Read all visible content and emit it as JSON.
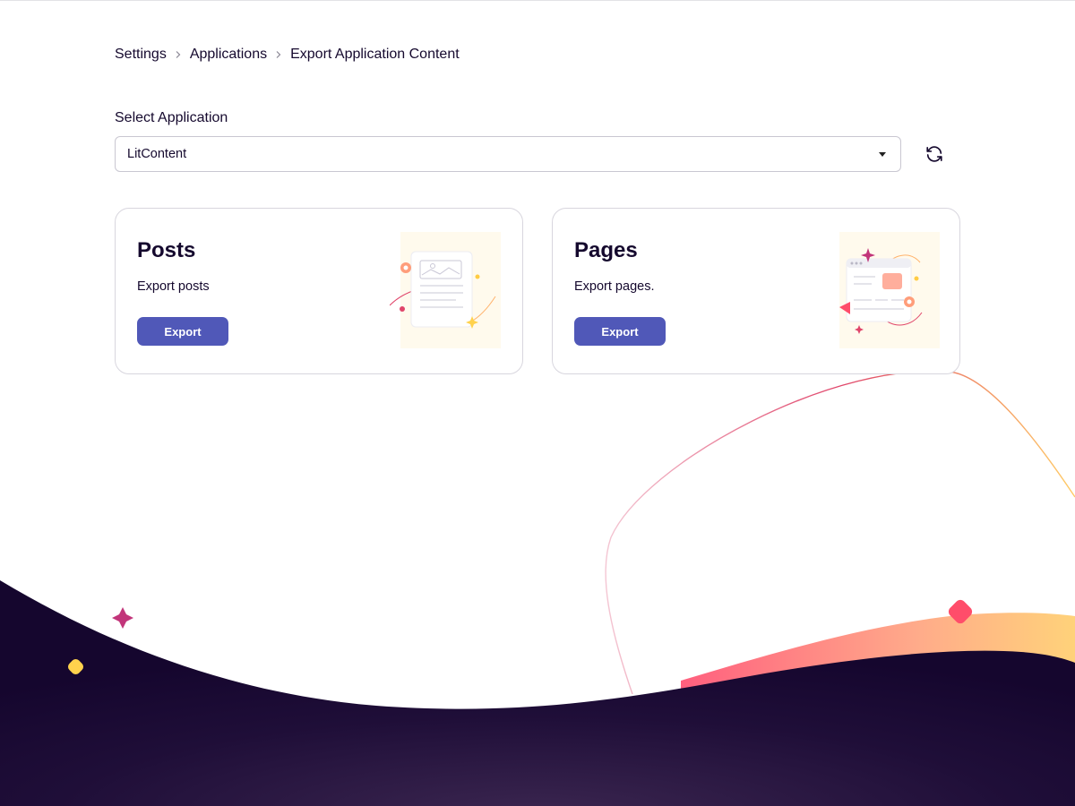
{
  "breadcrumb": {
    "items": [
      "Settings",
      "Applications",
      "Export Application Content"
    ]
  },
  "select": {
    "label": "Select Application",
    "value": "LitContent"
  },
  "cards": [
    {
      "title": "Posts",
      "description": "Export posts",
      "button": "Export"
    },
    {
      "title": "Pages",
      "description": "Export pages.",
      "button": "Export"
    }
  ],
  "icons": {
    "breadcrumb_separator": "chevron-right-icon",
    "select_caret": "caret-down-icon",
    "refresh": "refresh-icon"
  },
  "colors": {
    "primary": "#5058b8",
    "text": "#15092e",
    "footer_dark": "#15062e",
    "accent_pink": "#c2357a",
    "accent_yellow": "#ffd24d",
    "accent_red": "#ff4d6a"
  }
}
